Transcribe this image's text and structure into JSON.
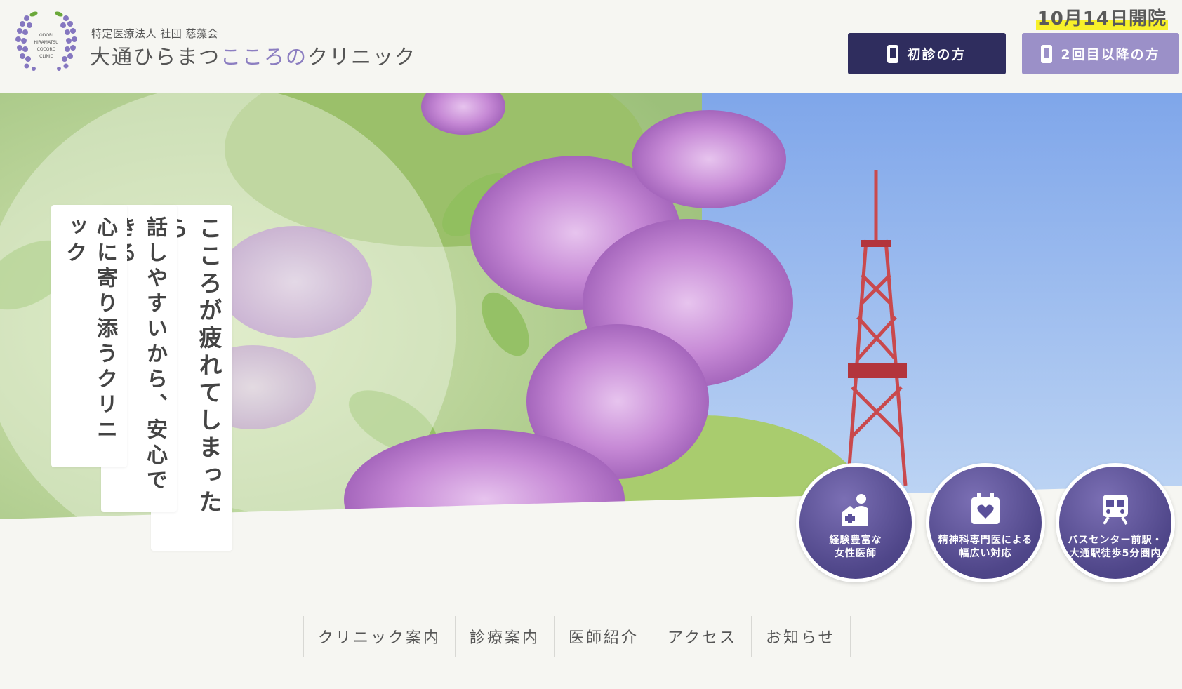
{
  "header": {
    "org_name": "特定医療法人 社団 慈藻会",
    "clinic_name_prefix": "大通ひらまつ",
    "clinic_name_accent": "こころの",
    "clinic_name_suffix": "クリニック",
    "logo_text": [
      "ODORI",
      "HIRAMATSU",
      "COCORO",
      "CLINIC"
    ],
    "opening": "10月14日開院",
    "btn_first": "初診の方",
    "btn_repeat": "2回目以降の方"
  },
  "hero": {
    "taglines": [
      "こころが疲れてしまったら…",
      "話しやすいから、安心できる",
      "心に寄り添うクリニック"
    ]
  },
  "features": [
    {
      "icon": "doctor-icon",
      "line1": "経験豊富な",
      "line2": "女性医師"
    },
    {
      "icon": "heart-calendar-icon",
      "line1": "精神科専門医による",
      "line2": "幅広い対応"
    },
    {
      "icon": "bus-icon",
      "line1": "バスセンター前駅・",
      "line2": "大通駅徒歩5分圏内"
    }
  ],
  "nav": [
    "クリニック案内",
    "診療案内",
    "医師紹介",
    "アクセス",
    "お知らせ"
  ],
  "colors": {
    "navy": "#2f2d5e",
    "lavender": "#9b90c8",
    "accent": "#8c7ec1",
    "highlight": "#f7f02a"
  }
}
